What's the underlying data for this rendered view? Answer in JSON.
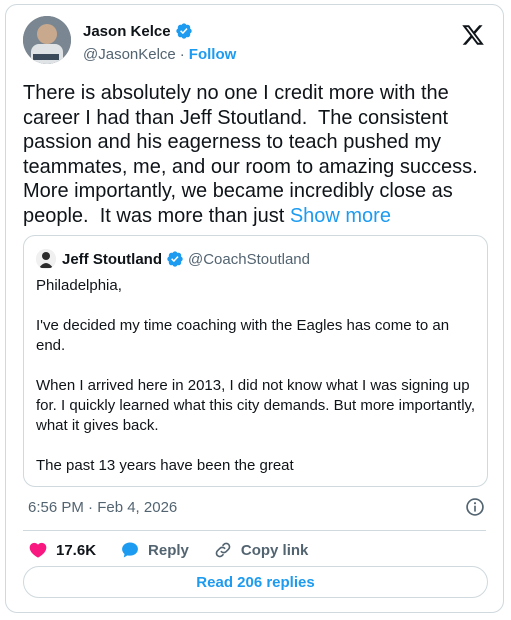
{
  "author": {
    "name": "Jason Kelce",
    "handle": "@JasonKelce",
    "separator": "·",
    "follow_label": "Follow",
    "verified": true
  },
  "tweet": {
    "text": "There is absolutely no one I credit more with the career I had than Jeff Stoutland.  The consistent passion and his eagerness to teach pushed my teammates, me, and our room to amazing success. More importantly, we became incredibly close as people.  It was more than just ",
    "show_more_label": "Show more"
  },
  "quote": {
    "name": "Jeff Stoutland",
    "handle": "@CoachStoutland",
    "verified": true,
    "paragraphs": [
      "Philadelphia,",
      "I've decided my time coaching with the Eagles has come to an end.",
      "When I arrived here in 2013, I did not know what I was signing up for. I quickly learned what this city demands. But more importantly, what it gives back.",
      "The past 13 years have been the great"
    ]
  },
  "meta": {
    "timestamp": "6:56 PM · Feb 4, 2026"
  },
  "actions": {
    "likes": "17.6K",
    "reply_label": "Reply",
    "copy_link_label": "Copy link"
  },
  "footer": {
    "read_replies_label": "Read 206 replies"
  },
  "colors": {
    "accent": "#1d9bf0",
    "like": "#f91880",
    "text": "#0f1419",
    "secondary": "#536471",
    "border": "#cfd9de"
  }
}
